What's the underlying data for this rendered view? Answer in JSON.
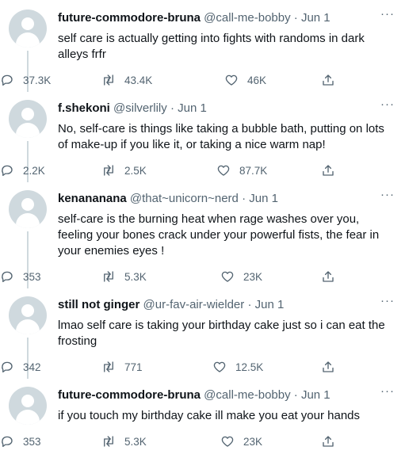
{
  "tweets": [
    {
      "name": "future-commodore-bruna",
      "handle": "@call-me-bobby",
      "date": "Jun 1",
      "text": "self care is actually getting into fights with randoms in dark alleys frfr",
      "replies": "37.3K",
      "retweets": "43.4K",
      "likes": "46K"
    },
    {
      "name": "f.shekoni",
      "handle": "@silverlily",
      "date": "Jun 1",
      "text": "No, self-care is things like taking a bubble bath, putting on lots of make-up if you like it, or taking a nice warm nap!",
      "replies": "2.2K",
      "retweets": "2.5K",
      "likes": "87.7K"
    },
    {
      "name": "kenananana",
      "handle": "@that~unicorn~nerd",
      "date": "Jun 1",
      "text": "self-care is the burning heat when rage washes over you, feeling your bones crack under your powerful fists, the fear in your enemies eyes !",
      "replies": "353",
      "retweets": "5.3K",
      "likes": "23K"
    },
    {
      "name": "still not ginger",
      "handle": "@ur-fav-air-wielder",
      "date": "Jun 1",
      "text": "lmao self care is taking your birthday cake just so i can eat the frosting",
      "replies": "342",
      "retweets": "771",
      "likes": "12.5K"
    },
    {
      "name": "future-commodore-bruna",
      "handle": "@call-me-bobby",
      "date": "Jun 1",
      "text": "if you touch my birthday cake ill make you eat your hands",
      "replies": "353",
      "retweets": "5.3K",
      "likes": "23K"
    }
  ],
  "separator": "·",
  "icons": [
    "reply-icon",
    "retweet-icon",
    "like-icon",
    "share-icon",
    "more-icon",
    "avatar-placeholder"
  ],
  "colors": {
    "text": "#0f1419",
    "secondary": "#536471",
    "avatar": "#cfd9de",
    "thread_line": "#cfd9de"
  }
}
